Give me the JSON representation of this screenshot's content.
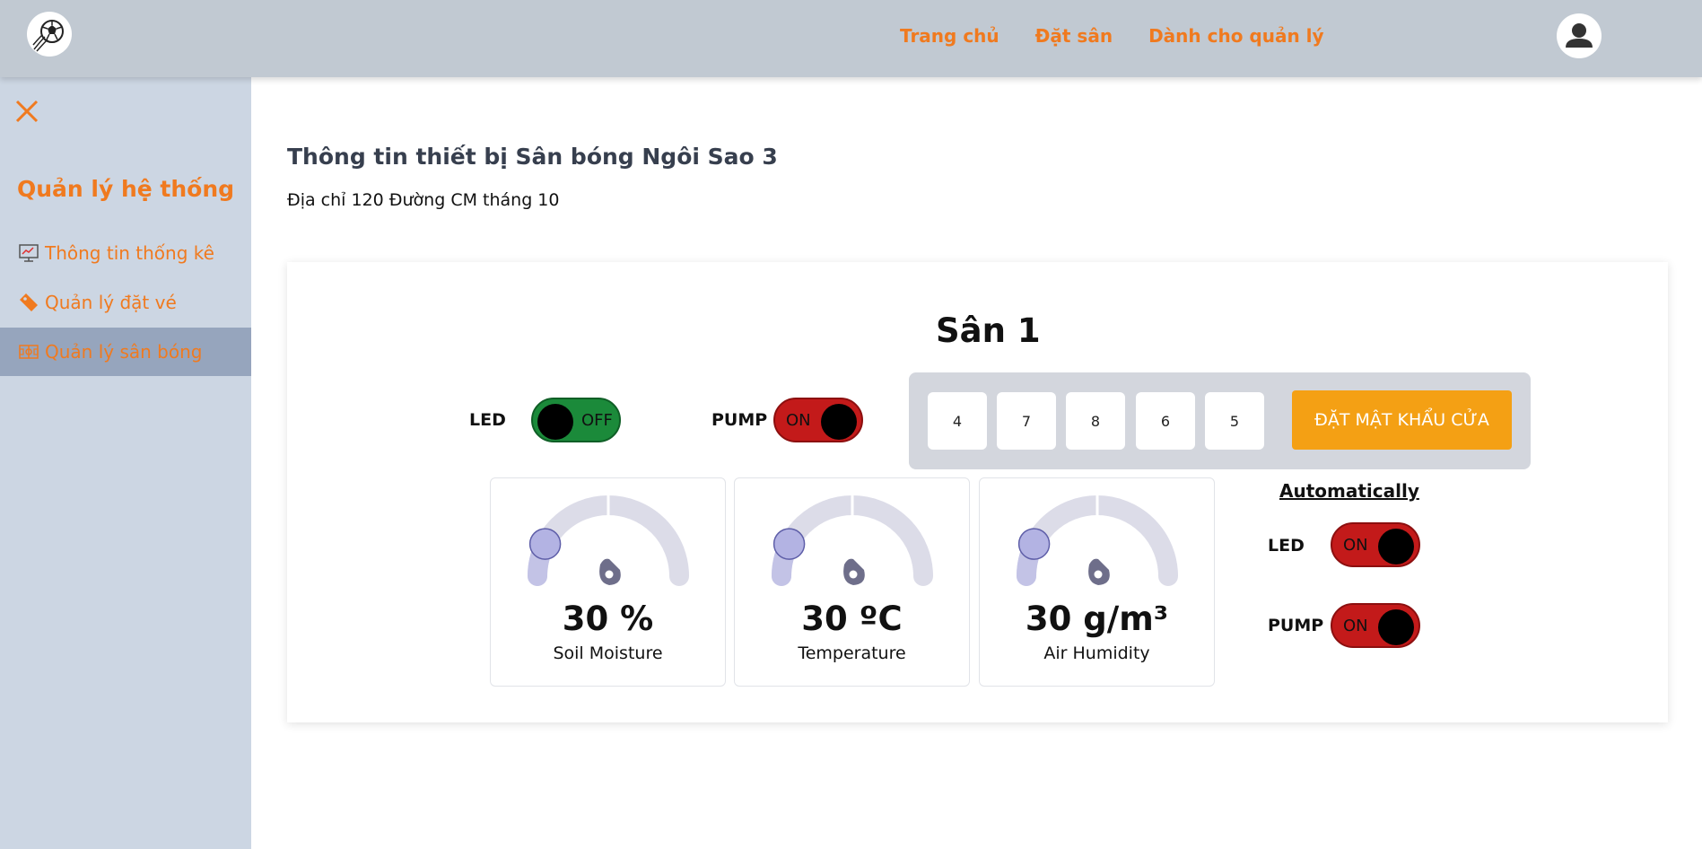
{
  "header": {
    "nav": [
      "Trang chủ",
      "Đặt sân",
      "Dành cho quản lý"
    ]
  },
  "sidebar": {
    "title": "Quản lý hệ thống",
    "items": [
      {
        "label": "Thông tin thống kê",
        "icon": "chart-icon"
      },
      {
        "label": "Quản lý đặt vé",
        "icon": "ticket-icon"
      },
      {
        "label": "Quản lý sân bóng",
        "icon": "field-icon",
        "active": true
      }
    ]
  },
  "main": {
    "title": "Thông tin thiết bị Sân bóng Ngôi Sao 3",
    "address": "Địa chỉ 120 Đường CM tháng 10",
    "field_name": "Sân 1",
    "controls": {
      "led": {
        "label": "LED",
        "state": "OFF"
      },
      "pump": {
        "label": "PUMP",
        "state": "ON"
      }
    },
    "password": {
      "digits": [
        "4",
        "7",
        "8",
        "6",
        "5"
      ],
      "button": "ĐẶT MẬT KHẨU CỬA"
    },
    "sensors": [
      {
        "value": "30 %",
        "label": "Soil Moisture",
        "level": 0.3
      },
      {
        "value": "30 ºC",
        "label": "Temperature",
        "level": 0.3
      },
      {
        "value": "30 g/m³",
        "label": "Air Humidity",
        "level": 0.3
      }
    ],
    "automatic": {
      "title": "Automatically",
      "led": {
        "label": "LED",
        "state": "ON"
      },
      "pump": {
        "label": "PUMP",
        "state": "ON"
      }
    }
  },
  "colors": {
    "accent": "#f07a1f",
    "header_bg": "#c1c9d2",
    "sidebar_bg": "#ccd6e3",
    "sidebar_active": "#96a5bd",
    "toggle_on": "#c31a1a",
    "toggle_off": "#1b8a3a",
    "button": "#f4a014"
  }
}
